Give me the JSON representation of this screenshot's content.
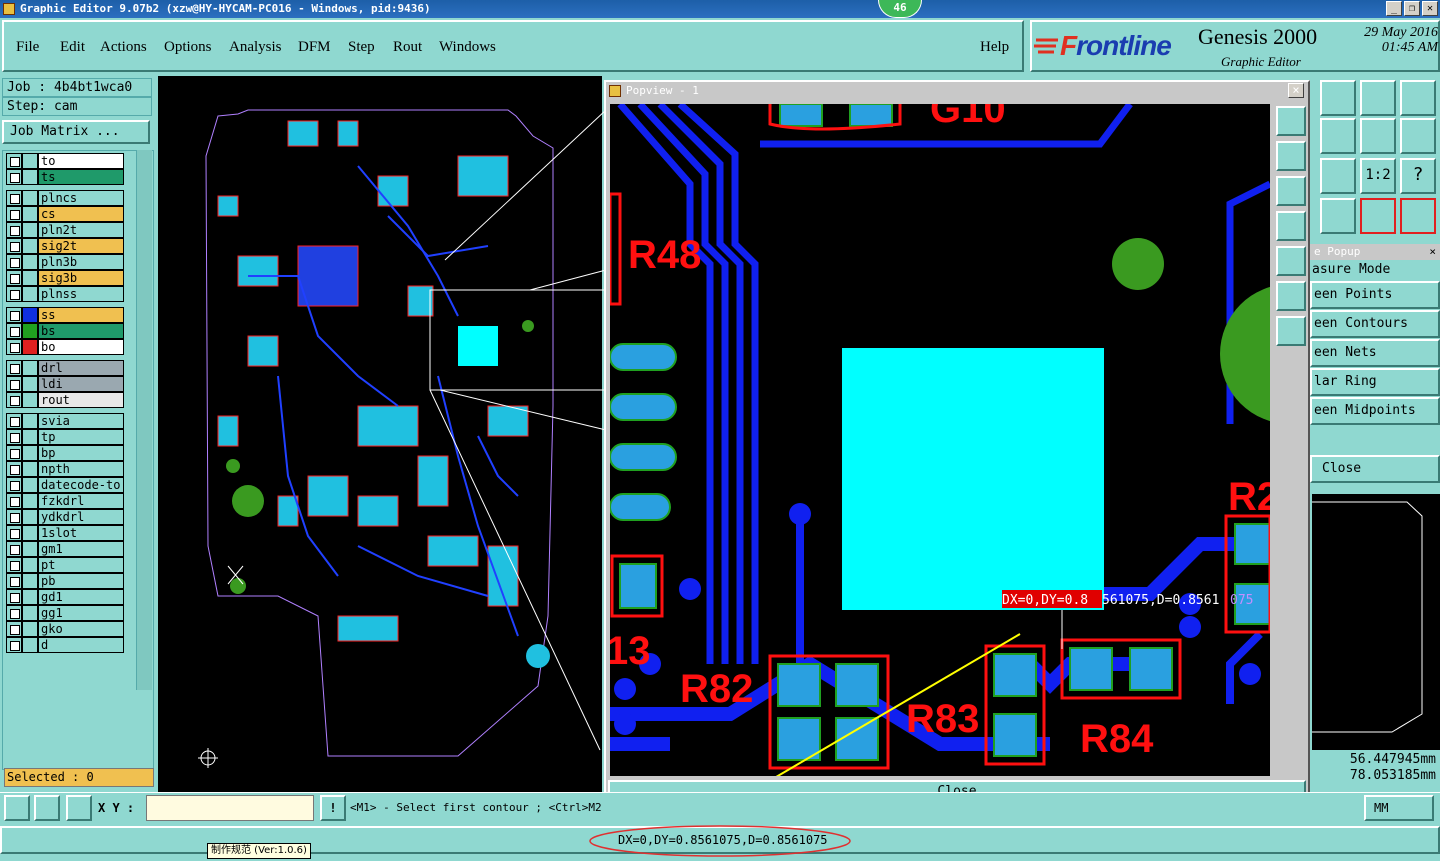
{
  "app": {
    "title": "Graphic Editor 9.07b2 (xzw@HY-HYCAM-PC016 - Windows, pid:9436)",
    "badge": "46",
    "win_min": "_",
    "win_max": "❐",
    "win_close": "✕"
  },
  "menu": {
    "items": [
      "File",
      "Edit",
      "Actions",
      "Options",
      "Analysis",
      "DFM",
      "Step",
      "Rout",
      "Windows"
    ],
    "help": "Help"
  },
  "brand": {
    "logo_f": "F",
    "logo_rest": "rontline",
    "product": "Genesis 2000",
    "subtitle": "Graphic Editor",
    "date": "29 May 2016",
    "time": "01:45 AM"
  },
  "job": {
    "job_label": "Job : 4b4bt1wca0",
    "step_label": "Step: cam",
    "matrix_button": "Job Matrix ..."
  },
  "layers": [
    {
      "name": "to",
      "color": "#ffffff",
      "group": 1
    },
    {
      "name": "ts",
      "color": "#1f9a6a",
      "group": 1
    },
    {
      "name": "plncs",
      "color": "#8fd8d0",
      "group": 2
    },
    {
      "name": "cs",
      "color": "#f0c050",
      "group": 2
    },
    {
      "name": "pln2t",
      "color": "#8fd8d0",
      "group": 2
    },
    {
      "name": "sig2t",
      "color": "#f0c050",
      "group": 2
    },
    {
      "name": "pln3b",
      "color": "#8fd8d0",
      "group": 2
    },
    {
      "name": "sig3b",
      "color": "#f0c050",
      "group": 2
    },
    {
      "name": "plnss",
      "color": "#8fd8d0",
      "group": 2
    },
    {
      "name": "ss",
      "color": "#f0c050",
      "group": 3,
      "sw": "#1030e0"
    },
    {
      "name": "bs",
      "color": "#1f9a6a",
      "group": 3,
      "sw": "#20a020"
    },
    {
      "name": "bo",
      "color": "#ffffff",
      "group": 3,
      "sw": "#e02020"
    },
    {
      "name": "drl",
      "color": "#9aa8b0",
      "group": 4
    },
    {
      "name": "ldi",
      "color": "#9aa8b0",
      "group": 4
    },
    {
      "name": "rout",
      "color": "#e8e8e8",
      "group": 4
    },
    {
      "name": "svia",
      "color": "#8fd8d0",
      "group": 5
    },
    {
      "name": "tp",
      "color": "#8fd8d0",
      "group": 5
    },
    {
      "name": "bp",
      "color": "#8fd8d0",
      "group": 5
    },
    {
      "name": "npth",
      "color": "#8fd8d0",
      "group": 5
    },
    {
      "name": "datecode-to",
      "color": "#8fd8d0",
      "group": 5
    },
    {
      "name": "fzkdrl",
      "color": "#8fd8d0",
      "group": 5
    },
    {
      "name": "ydkdrl",
      "color": "#8fd8d0",
      "group": 5
    },
    {
      "name": "1slot",
      "color": "#8fd8d0",
      "group": 5
    },
    {
      "name": "gm1",
      "color": "#8fd8d0",
      "group": 5
    },
    {
      "name": "pt",
      "color": "#8fd8d0",
      "group": 5
    },
    {
      "name": "pb",
      "color": "#8fd8d0",
      "group": 5
    },
    {
      "name": "gd1",
      "color": "#8fd8d0",
      "group": 5
    },
    {
      "name": "gg1",
      "color": "#8fd8d0",
      "group": 5
    },
    {
      "name": "gko",
      "color": "#8fd8d0",
      "group": 5
    },
    {
      "name": "d",
      "color": "#8fd8d0",
      "group": 5
    }
  ],
  "selected": "Selected : 0",
  "popview": {
    "title": "Popview - 1",
    "close": "Close",
    "labels": [
      "R48",
      "R82",
      "R84",
      "R83",
      "R2",
      "13",
      "G10"
    ],
    "measure_text_a": "DX=0,DY=0.8",
    "measure_text_b": "561075,D=0.8561",
    "measure_text_c": "075"
  },
  "measure": {
    "title": "e Popup",
    "mode": "asure Mode",
    "items": [
      "een Points",
      "een Contours",
      "een Nets",
      "lar Ring",
      "een Midpoints"
    ],
    "close": "Close"
  },
  "coords": {
    "x": "56.447945mm",
    "y": "78.053185mm"
  },
  "bottom": {
    "xy_label": "X Y :",
    "xy_value": "",
    "message": "<M1> - Select first contour ; <Ctrl>M2",
    "unit": "MM",
    "status": "DX=0,DY=0.8561075,D=0.8561075",
    "tooltip": "制作规范 (Ver:1.0.6)"
  }
}
